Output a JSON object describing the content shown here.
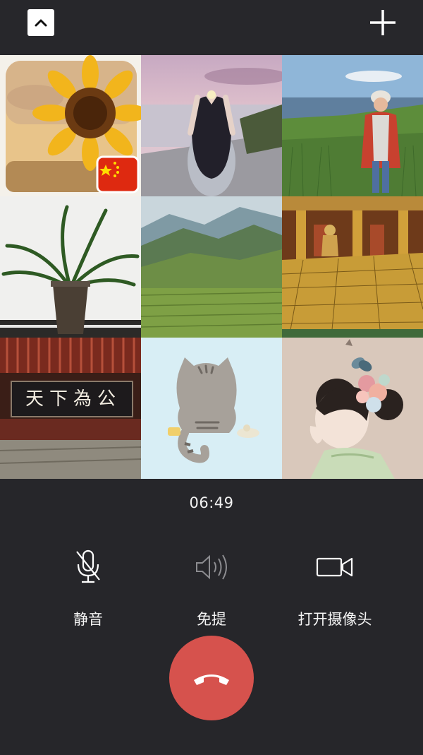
{
  "call": {
    "duration": "06:49"
  },
  "controls": {
    "mute_label": "静音",
    "speaker_label": "免提",
    "camera_label": "打开摄像头"
  },
  "participants": [
    {
      "avatar": "sunflower with china flag"
    },
    {
      "avatar": "girl making heart by sea"
    },
    {
      "avatar": "woman standing in grassland by lake"
    },
    {
      "avatar": "potted plant"
    },
    {
      "avatar": "green mountain valley"
    },
    {
      "avatar": "golden palace hall"
    },
    {
      "avatar": "plaque 天下為公"
    },
    {
      "avatar": "cartoon cat from behind"
    },
    {
      "avatar": "painted girl with flowers and butterfly"
    }
  ],
  "plaque_text": "天下為公",
  "colors": {
    "background": "#26262a",
    "hangup": "#d6524d",
    "icon": "#ffffff"
  }
}
